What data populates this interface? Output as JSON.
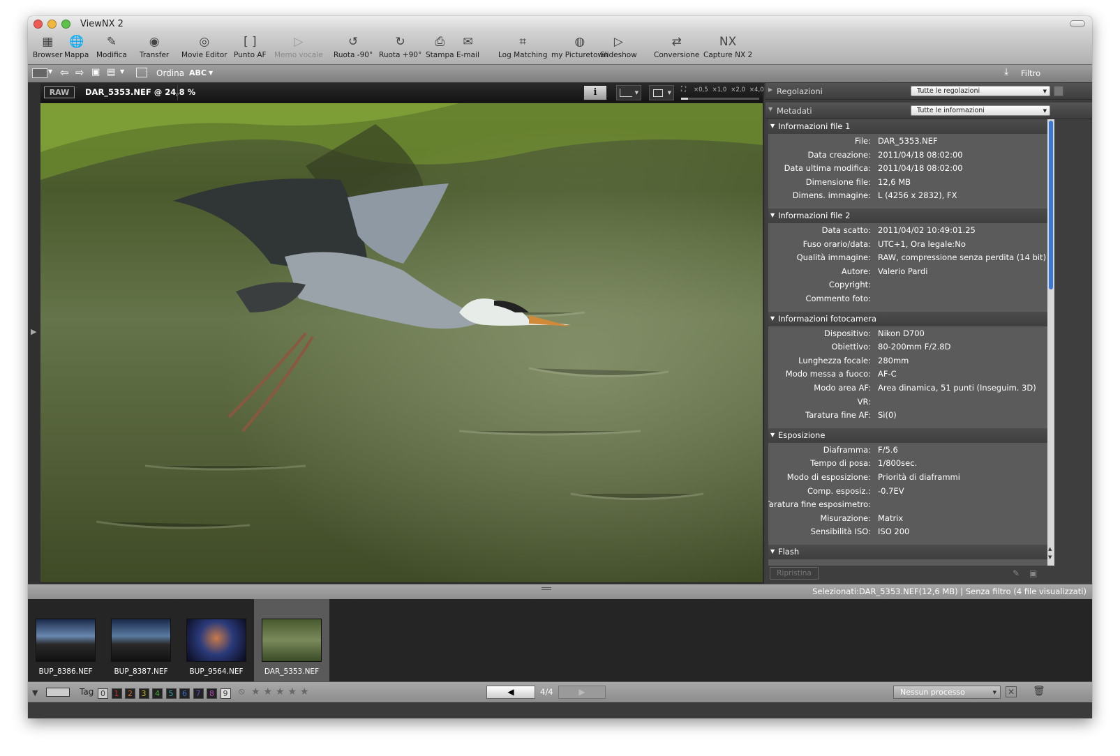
{
  "window": {
    "title": "ViewNX 2"
  },
  "toolbar": {
    "items": [
      {
        "label": "Browser",
        "icon": "browser-icon"
      },
      {
        "label": "Mappa",
        "icon": "globe-icon"
      },
      {
        "label": "Modifica",
        "icon": "edit-icon"
      },
      {
        "label": "Transfer",
        "icon": "camera-icon"
      },
      {
        "label": "Movie Editor",
        "icon": "film-icon"
      },
      {
        "label": "Punto AF",
        "icon": "af-point-icon"
      },
      {
        "label": "Memo vocale",
        "icon": "play-icon"
      },
      {
        "label": "Ruota -90°",
        "icon": "rotate-left-icon"
      },
      {
        "label": "Ruota +90°",
        "icon": "rotate-right-icon"
      },
      {
        "label": "Stampa",
        "icon": "print-icon"
      },
      {
        "label": "E-mail",
        "icon": "mail-icon"
      },
      {
        "label": "Log Matching",
        "icon": "log-icon"
      },
      {
        "label": "my Picturetown",
        "icon": "picturetown-icon"
      },
      {
        "label": "Slideshow",
        "icon": "slideshow-icon"
      },
      {
        "label": "Conversione",
        "icon": "convert-icon"
      },
      {
        "label": "Capture NX 2",
        "icon": "capture-nx-icon"
      }
    ]
  },
  "subbar": {
    "sort_label": "Ordina",
    "sort_value": "ABC",
    "filter_label": "Filtro"
  },
  "viewer": {
    "raw_badge": "RAW",
    "filename": "DAR_5353.NEF @ 24,8 %",
    "zoom_options": [
      "×0,5",
      "×1,0",
      "×2,0",
      "×4,0"
    ]
  },
  "panel": {
    "adjust_label": "Regolazioni",
    "adjust_select": "Tutte le regolazioni",
    "meta_label": "Metadati",
    "meta_select": "Tutte le informazioni",
    "reset_button": "Ripristina",
    "sections": [
      {
        "title": "Informazioni file 1",
        "rows": [
          {
            "k": "File:",
            "v": "DAR_5353.NEF"
          },
          {
            "k": "Data creazione:",
            "v": "2011/04/18 08:02:00"
          },
          {
            "k": "Data ultima modifica:",
            "v": "2011/04/18 08:02:00"
          },
          {
            "k": "Dimensione file:",
            "v": "12,6 MB"
          },
          {
            "k": "Dimens. immagine:",
            "v": "L (4256 x 2832), FX"
          }
        ]
      },
      {
        "title": "Informazioni file 2",
        "rows": [
          {
            "k": "Data scatto:",
            "v": "2011/04/02 10:49:01.25"
          },
          {
            "k": "Fuso orario/data:",
            "v": "UTC+1, Ora legale:No"
          },
          {
            "k": "Qualità immagine:",
            "v": "RAW, compressione senza perdita (14 bit)"
          },
          {
            "k": "Autore:",
            "v": "Valerio Pardi"
          },
          {
            "k": "Copyright:",
            "v": ""
          },
          {
            "k": "Commento foto:",
            "v": ""
          }
        ]
      },
      {
        "title": "Informazioni fotocamera",
        "rows": [
          {
            "k": "Dispositivo:",
            "v": "Nikon D700"
          },
          {
            "k": "Obiettivo:",
            "v": "80-200mm F/2.8D"
          },
          {
            "k": "Lunghezza focale:",
            "v": "280mm"
          },
          {
            "k": "Modo messa a fuoco:",
            "v": "AF-C"
          },
          {
            "k": "Modo area AF:",
            "v": "Area dinamica, 51 punti (Inseguim. 3D)"
          },
          {
            "k": "VR:",
            "v": ""
          },
          {
            "k": "Taratura fine AF:",
            "v": "Sì(0)"
          }
        ]
      },
      {
        "title": "Esposizione",
        "rows": [
          {
            "k": "Diaframma:",
            "v": "F/5.6"
          },
          {
            "k": "Tempo di posa:",
            "v": "1/800sec."
          },
          {
            "k": "Modo di esposizione:",
            "v": "Priorità di diaframmi"
          },
          {
            "k": "Comp. esposiz.:",
            "v": "-0.7EV"
          },
          {
            "k": "Taratura fine esposimetro:",
            "v": ""
          },
          {
            "k": "Misurazione:",
            "v": "Matrix"
          },
          {
            "k": "Sensibilità ISO:",
            "v": "ISO 200"
          }
        ]
      },
      {
        "title": "Flash",
        "rows": []
      }
    ]
  },
  "status": {
    "text": "Selezionati:DAR_5353.NEF(12,6 MB) | Senza filtro (4 file visualizzati)"
  },
  "thumbnails": [
    {
      "name": "BUP_8386.NEF"
    },
    {
      "name": "BUP_8387.NEF"
    },
    {
      "name": "BUP_9564.NEF"
    },
    {
      "name": "DAR_5353.NEF"
    }
  ],
  "bottombar": {
    "tag_label": "Tag",
    "tags": [
      "0",
      "1",
      "2",
      "3",
      "4",
      "5",
      "6",
      "7",
      "8",
      "9"
    ],
    "tag_colors": [
      "#888",
      "#c83232",
      "#c86a2a",
      "#c8b428",
      "#48a83a",
      "#3aa0a8",
      "#3a68c8",
      "#6a48c8",
      "#b848b8",
      "#bbbbbb"
    ],
    "nav": "4/4",
    "process_select": "Nessun processo"
  }
}
